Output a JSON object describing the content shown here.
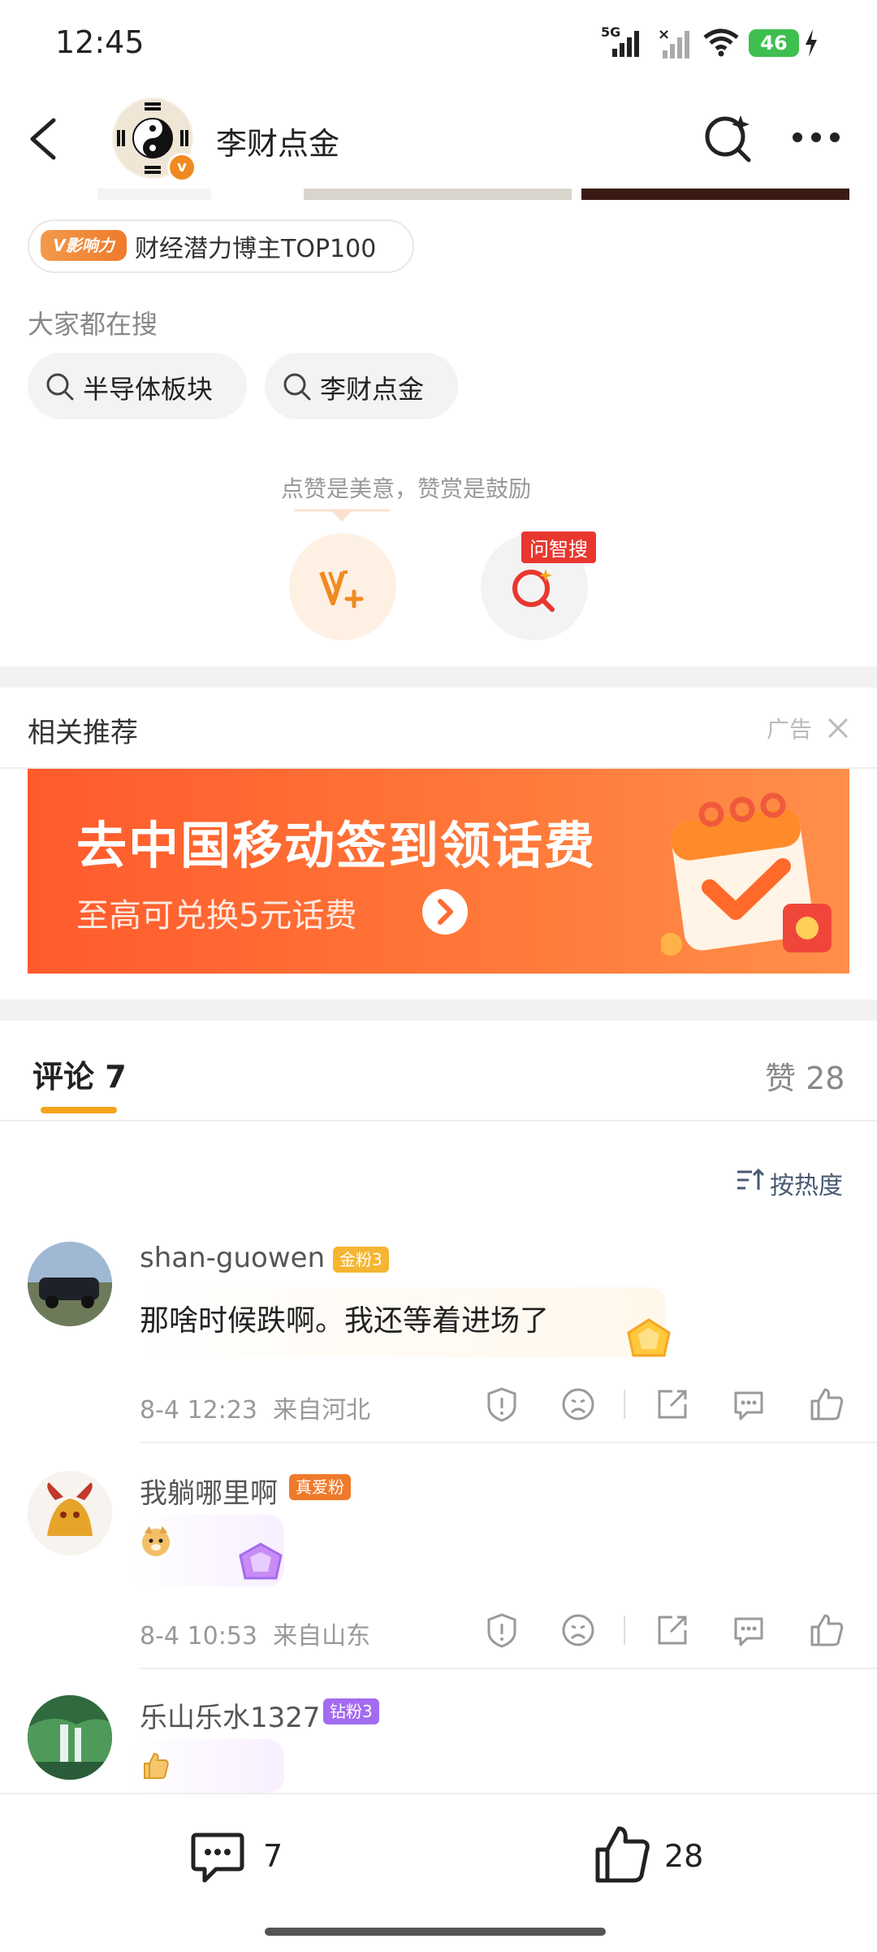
{
  "status_bar": {
    "time": "12:45",
    "network": "5G",
    "battery": "46"
  },
  "nav": {
    "title": "李财点金"
  },
  "badge": {
    "tag": "V影响力",
    "text": "财经潜力博主TOP100"
  },
  "search_section": {
    "label": "大家都在搜",
    "chips": [
      "半导体板块",
      "李财点金"
    ]
  },
  "reward": {
    "hint": "点赞是美意，赞赏是鼓励",
    "ask_tag": "问智搜"
  },
  "recommend": {
    "title": "相关推荐",
    "ad_label": "广告"
  },
  "banner": {
    "title": "去中国移动签到领话费",
    "subtitle": "至高可兑换5元话费"
  },
  "tabs": {
    "comments": "评论 7",
    "likes": "赞 28"
  },
  "sort": {
    "label": "按热度"
  },
  "comments": [
    {
      "username": "shan-guowen",
      "badge": "金粉3",
      "badge_color": "#f5b532",
      "text": "那啥时候跌啊。我还等着进场了",
      "date": "8-4 12:23",
      "location": "来自河北"
    },
    {
      "username": "我躺哪里啊",
      "badge": "真爱粉",
      "badge_color": "#f07a2b",
      "text": "",
      "date": "8-4 10:53",
      "location": "来自山东"
    },
    {
      "username": "乐山乐水1327",
      "badge": "钻粉3",
      "badge_color": "#a36cf0",
      "text": "",
      "date": "",
      "location": ""
    }
  ],
  "bottom_bar": {
    "comment_count": "7",
    "like_count": "28"
  },
  "colors": {
    "accent": "#f7a21b",
    "orange": "#f07a2b",
    "banner": "#ff6a35"
  }
}
